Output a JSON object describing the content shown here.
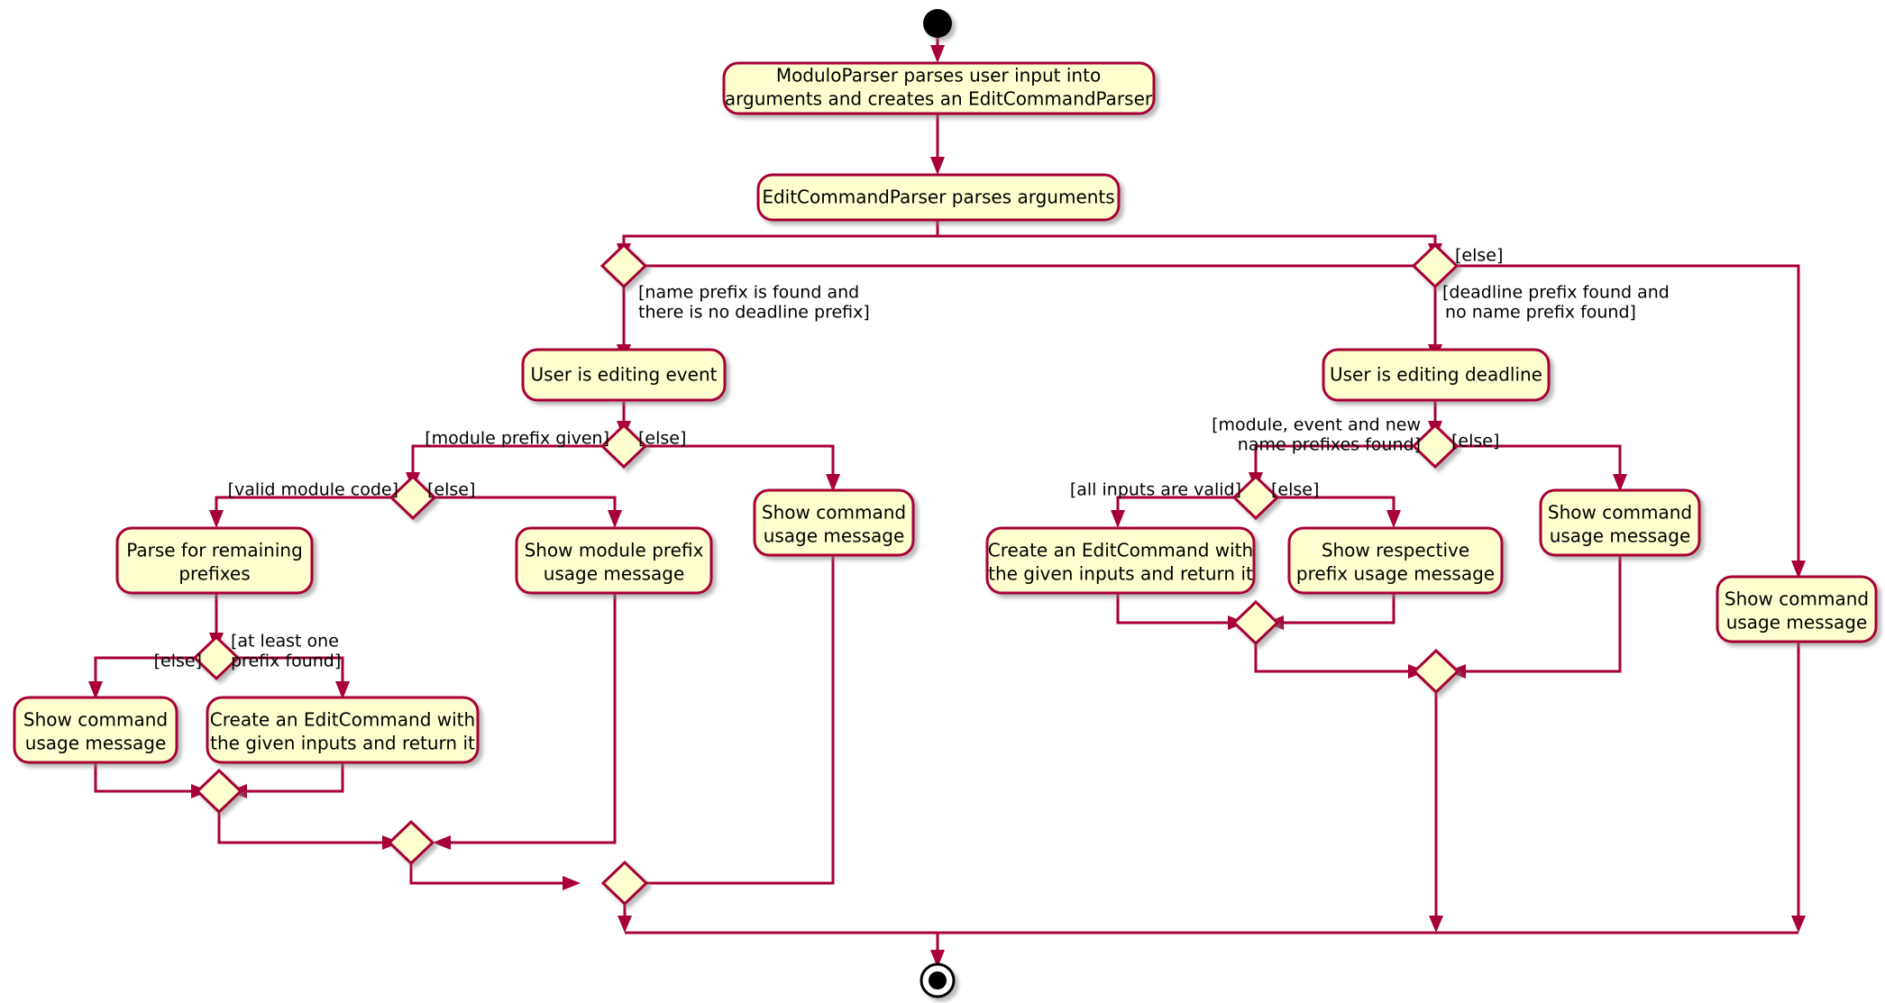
{
  "diagram": {
    "type": "uml-activity-diagram",
    "title": "EditCommand parsing activity diagram",
    "colors": {
      "node_fill": "#FEFECE",
      "node_border": "#A80036",
      "edge": "#A80036",
      "text": "#000000",
      "background": "#FFFFFF"
    },
    "start_node": "start",
    "end_node": "end",
    "activities": [
      {
        "id": "a1",
        "label_lines": [
          "ModuloParser parses user input into",
          "arguments and creates an EditCommandParser"
        ]
      },
      {
        "id": "a2",
        "label_lines": [
          "EditCommandParser parses arguments"
        ]
      },
      {
        "id": "a3",
        "label_lines": [
          "User is editing event"
        ]
      },
      {
        "id": "a4",
        "label_lines": [
          "User is editing deadline"
        ]
      },
      {
        "id": "a5",
        "label_lines": [
          "Parse for remaining",
          "prefixes"
        ]
      },
      {
        "id": "a6",
        "label_lines": [
          "Show module prefix",
          "usage message"
        ]
      },
      {
        "id": "a7",
        "label_lines": [
          "Show command",
          "usage message"
        ]
      },
      {
        "id": "a8",
        "label_lines": [
          "Show command",
          "usage message"
        ]
      },
      {
        "id": "a9",
        "label_lines": [
          "Create an EditCommand with",
          "the given inputs and return it"
        ]
      },
      {
        "id": "a10",
        "label_lines": [
          "Create an EditCommand with",
          "the given inputs and return it"
        ]
      },
      {
        "id": "a11",
        "label_lines": [
          "Show respective",
          "prefix usage message"
        ]
      },
      {
        "id": "a12",
        "label_lines": [
          "Show command",
          "usage message"
        ]
      },
      {
        "id": "a13",
        "label_lines": [
          "Show command",
          "usage message"
        ]
      }
    ],
    "guards": [
      {
        "id": "g1",
        "lines": [
          "[name prefix is found and",
          "there is no deadline prefix]"
        ]
      },
      {
        "id": "g2",
        "lines": [
          "[else]"
        ]
      },
      {
        "id": "g3",
        "lines": [
          "[deadline prefix found and",
          "no name prefix found]"
        ]
      },
      {
        "id": "g4",
        "lines": [
          "[module prefix given]"
        ]
      },
      {
        "id": "g5",
        "lines": [
          "[else]"
        ]
      },
      {
        "id": "g6",
        "lines": [
          "[valid module code]"
        ]
      },
      {
        "id": "g7",
        "lines": [
          "[else]"
        ]
      },
      {
        "id": "g8",
        "lines": [
          "[at least one",
          "prefix found]"
        ]
      },
      {
        "id": "g9",
        "lines": [
          "[else]"
        ]
      },
      {
        "id": "g10",
        "lines": [
          "[module, event and new",
          "name prefixes found]"
        ]
      },
      {
        "id": "g11",
        "lines": [
          "[else]"
        ]
      },
      {
        "id": "g12",
        "lines": [
          "[all inputs are valid]"
        ]
      },
      {
        "id": "g13",
        "lines": [
          "[else]"
        ]
      }
    ]
  },
  "nodes": {
    "a1_l1": "ModuloParser parses user input into",
    "a1_l2": "arguments and creates an EditCommandParser",
    "a2_l1": "EditCommandParser parses arguments",
    "a3_l1": "User is editing event",
    "a4_l1": "User is editing deadline",
    "a5_l1": "Parse for remaining",
    "a5_l2": "prefixes",
    "a6_l1": "Show module prefix",
    "a6_l2": "usage message",
    "a7_l1": "Show command",
    "a7_l2": "usage message",
    "a8_l1": "Show command",
    "a8_l2": "usage message",
    "a9_l1": "Create an EditCommand with",
    "a9_l2": "the given inputs and return it",
    "a10_l1": "Create an EditCommand with",
    "a10_l2": "the given inputs and return it",
    "a11_l1": "Show respective",
    "a11_l2": "prefix usage message",
    "a12_l1": "Show command",
    "a12_l2": "usage message",
    "a13_l1": "Show command",
    "a13_l2": "usage message"
  },
  "guard_text": {
    "g1_l1": "[name prefix is found and",
    "g1_l2": "there is no deadline prefix]",
    "g2_l1": "[else]",
    "g3_l1": "[deadline prefix found and",
    "g3_l2": "no name prefix found]",
    "g4_l1": "[module prefix given]",
    "g5_l1": "[else]",
    "g6_l1": "[valid module code]",
    "g7_l1": "[else]",
    "g8_l1": "[at least one",
    "g8_l2": "prefix found]",
    "g9_l1": "[else]",
    "g10_l1": "[module, event and new",
    "g10_l2": "name prefixes found]",
    "g11_l1": "[else]",
    "g12_l1": "[all inputs are valid]",
    "g13_l1": "[else]"
  }
}
